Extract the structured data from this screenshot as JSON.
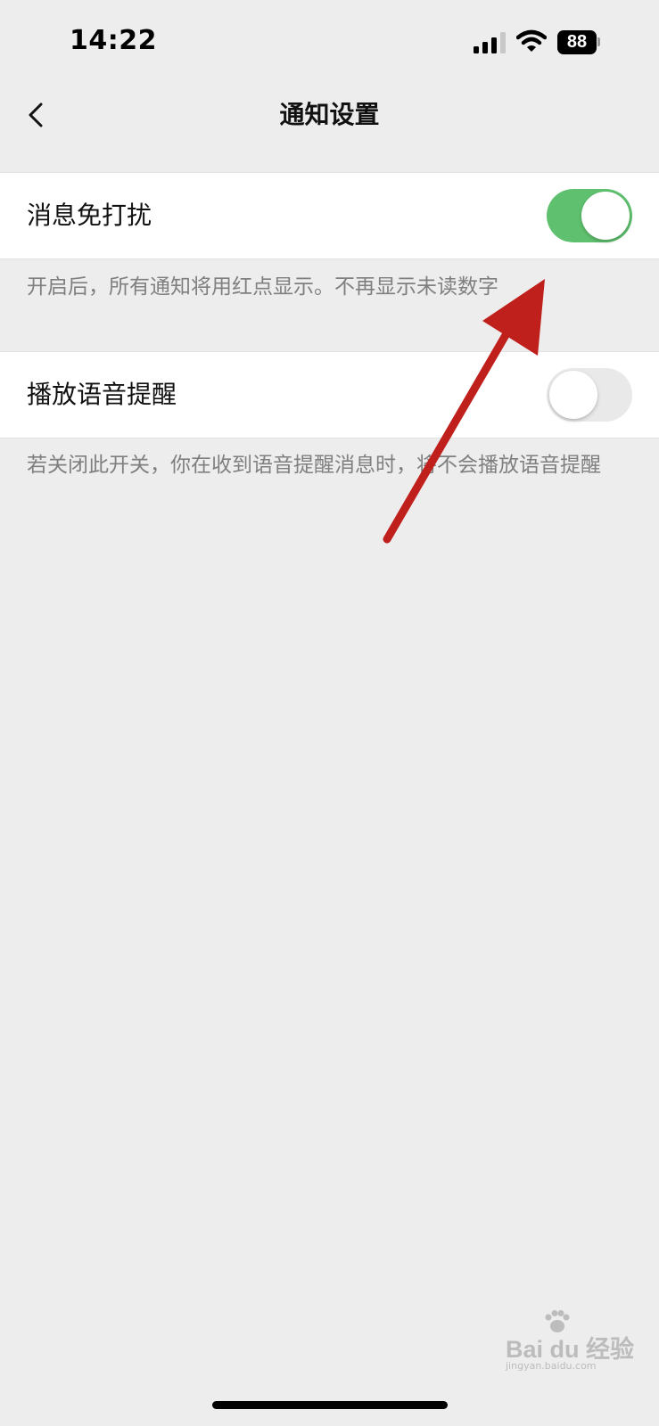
{
  "status_bar": {
    "time": "14:22",
    "battery_level": "88",
    "icons": [
      "signal-icon",
      "wifi-icon",
      "battery-icon"
    ]
  },
  "nav": {
    "title": "通知设置",
    "back_icon": "chevron-left-icon"
  },
  "settings": [
    {
      "label": "消息免打扰",
      "toggle_on": true,
      "description": "开启后，所有通知将用红点显示。不再显示未读数字"
    },
    {
      "label": "播放语音提醒",
      "toggle_on": false,
      "description": "若关闭此开关，你在收到语音提醒消息时，将不会播放语音提醒"
    }
  ],
  "colors": {
    "background": "#ededed",
    "toggle_on": "#5fc16f",
    "toggle_off": "#e9e9ea",
    "annotation_arrow": "#c0201c"
  },
  "watermark": {
    "logo": "Bai du 经验",
    "sub": "jingyan.baidu.com"
  }
}
